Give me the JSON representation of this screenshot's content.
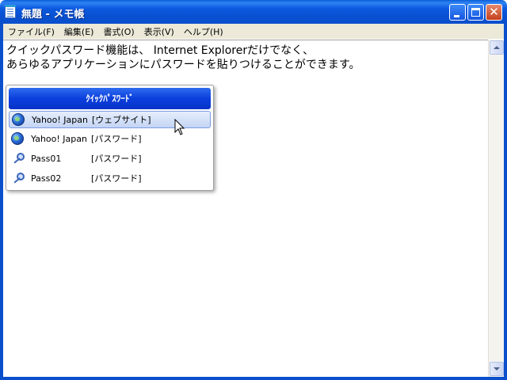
{
  "window": {
    "title": "無題 - メモ帳"
  },
  "menu": [
    {
      "label": "ファイル(F)"
    },
    {
      "label": "編集(E)"
    },
    {
      "label": "書式(O)"
    },
    {
      "label": "表示(V)"
    },
    {
      "label": "ヘルプ(H)"
    }
  ],
  "editor": {
    "line1": "クイックパスワード機能は、 Internet Explorerだけでなく、",
    "line2": "あらゆるアプリケーションにパスワードを貼りつけることができます。"
  },
  "quick_password": {
    "title": "ｸｲｯｸﾊﾟｽﾜｰﾄﾞ",
    "items": [
      {
        "name": "Yahoo! Japan",
        "type": "[ウェブサイト]",
        "icon": "globe-icon",
        "selected": true
      },
      {
        "name": "Yahoo! Japan",
        "type": "[パスワード]",
        "icon": "globe-icon",
        "selected": false
      },
      {
        "name": "Pass01",
        "type": "[パスワード]",
        "icon": "key-icon",
        "selected": false
      },
      {
        "name": "Pass02",
        "type": "[パスワード]",
        "icon": "key-icon",
        "selected": false
      }
    ]
  },
  "colors": {
    "titlebar": "#0a4fcc",
    "menubar": "#ece9d8",
    "popup_header": "#0b3fdc",
    "selected_row": "#c3d4f4"
  }
}
